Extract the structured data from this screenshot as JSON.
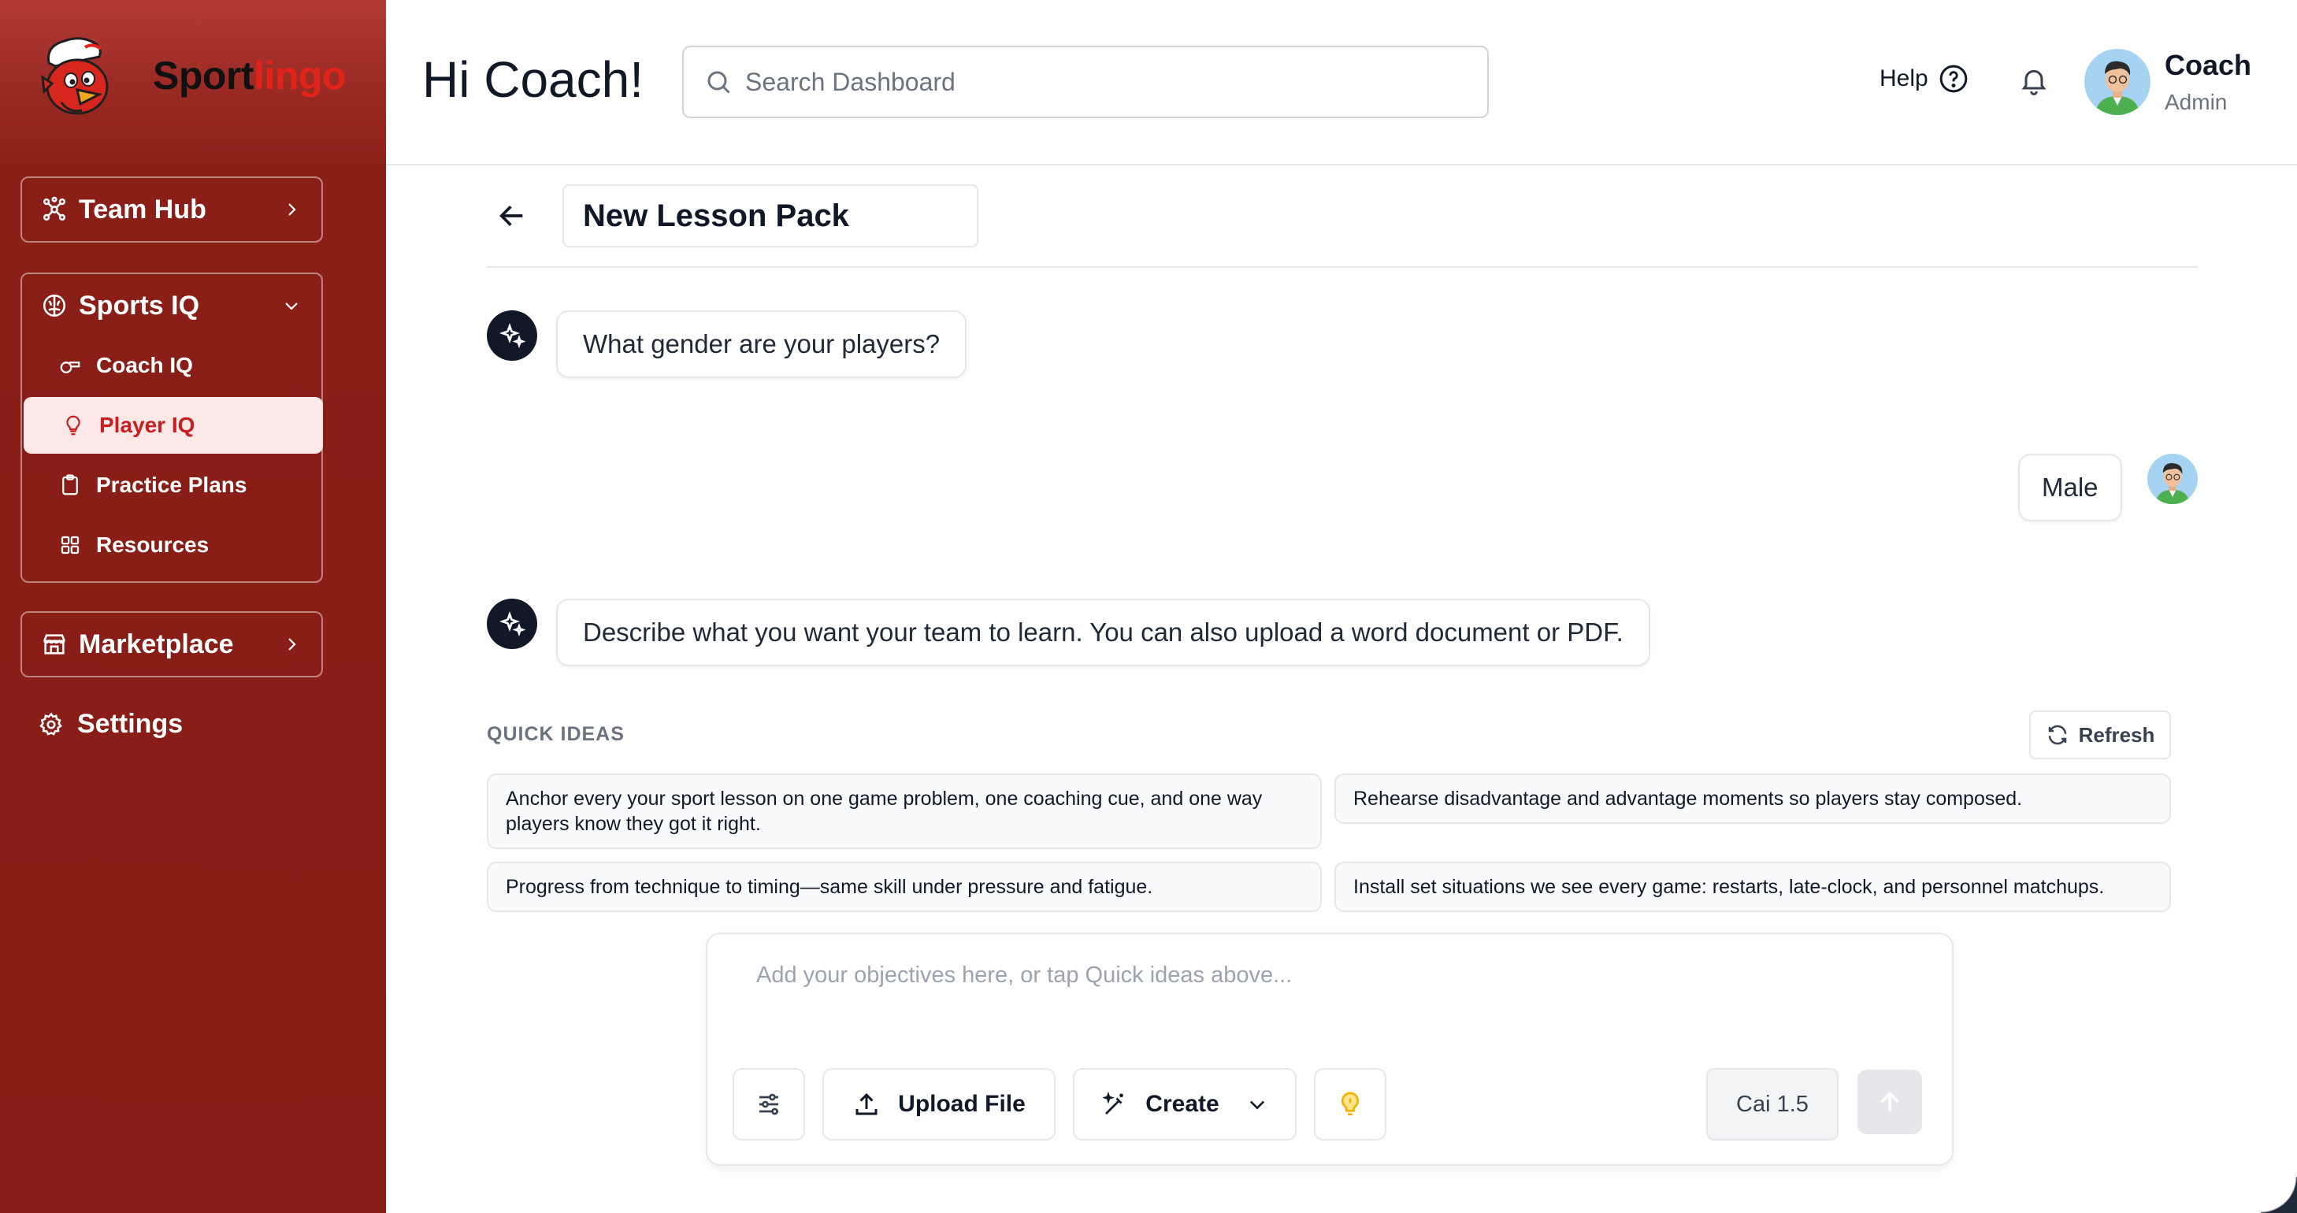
{
  "brand": {
    "name_part1": "Sport",
    "name_part2": "lingo"
  },
  "sidebar": {
    "team_hub": {
      "label": "Team Hub"
    },
    "sports_iq": {
      "label": "Sports IQ",
      "items": [
        {
          "label": "Coach IQ",
          "icon": "whistle-icon"
        },
        {
          "label": "Player IQ",
          "icon": "lightbulb-icon",
          "active": true
        },
        {
          "label": "Practice Plans",
          "icon": "clipboard-icon"
        },
        {
          "label": "Resources",
          "icon": "grid-icon"
        }
      ]
    },
    "marketplace": {
      "label": "Marketplace"
    },
    "settings": {
      "label": "Settings"
    }
  },
  "header": {
    "greeting": "Hi Coach!",
    "search_placeholder": "Search Dashboard",
    "help_label": "Help",
    "user_name": "Coach",
    "user_role": "Admin"
  },
  "lesson": {
    "title": "New Lesson Pack"
  },
  "chat": {
    "messages": [
      {
        "from": "assistant",
        "text": "What gender are your players?"
      },
      {
        "from": "user",
        "text": "Male"
      },
      {
        "from": "assistant",
        "text": "Describe what you want your team to learn. You can also upload a word document or PDF."
      }
    ]
  },
  "quick_ideas": {
    "label": "QUICK IDEAS",
    "refresh_label": "Refresh",
    "items": [
      "Anchor every your sport lesson on one game problem, one coaching cue, and one way players know they got it right.",
      "Rehearse disadvantage and advantage moments so players stay composed.",
      "Progress from technique to timing—same skill under pressure and fatigue.",
      "Install set situations we see every game: restarts, late-clock, and personnel matchups."
    ]
  },
  "composer": {
    "placeholder": "Add your objectives here, or tap Quick ideas above...",
    "upload_label": "Upload File",
    "create_label": "Create",
    "model_label": "Cai 1.5"
  },
  "colors": {
    "sidebar_bg": "#871d16",
    "brand_red": "#e2231a",
    "active_bg": "#fde8e8",
    "active_text": "#c81e1e",
    "idea_bulb": "#f5b000"
  }
}
